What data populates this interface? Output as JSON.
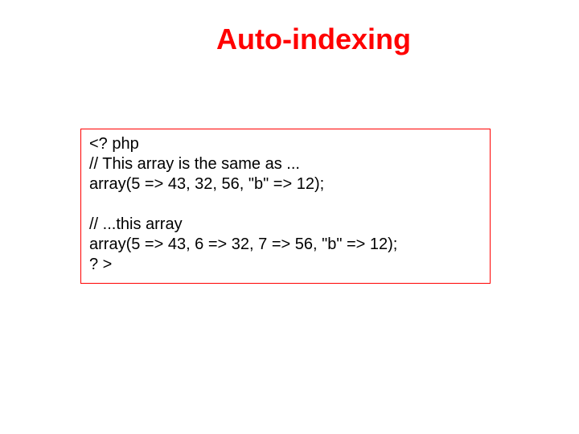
{
  "title": "Auto-indexing",
  "code": {
    "line1": "<? php",
    "line2": "// This array is the same as ...",
    "line3": "array(5 => 43, 32, 56, \"b\" => 12);",
    "line4": "// ...this array",
    "line5": "array(5 => 43, 6 => 32, 7 => 56, \"b\" => 12);",
    "line6": "? >"
  }
}
